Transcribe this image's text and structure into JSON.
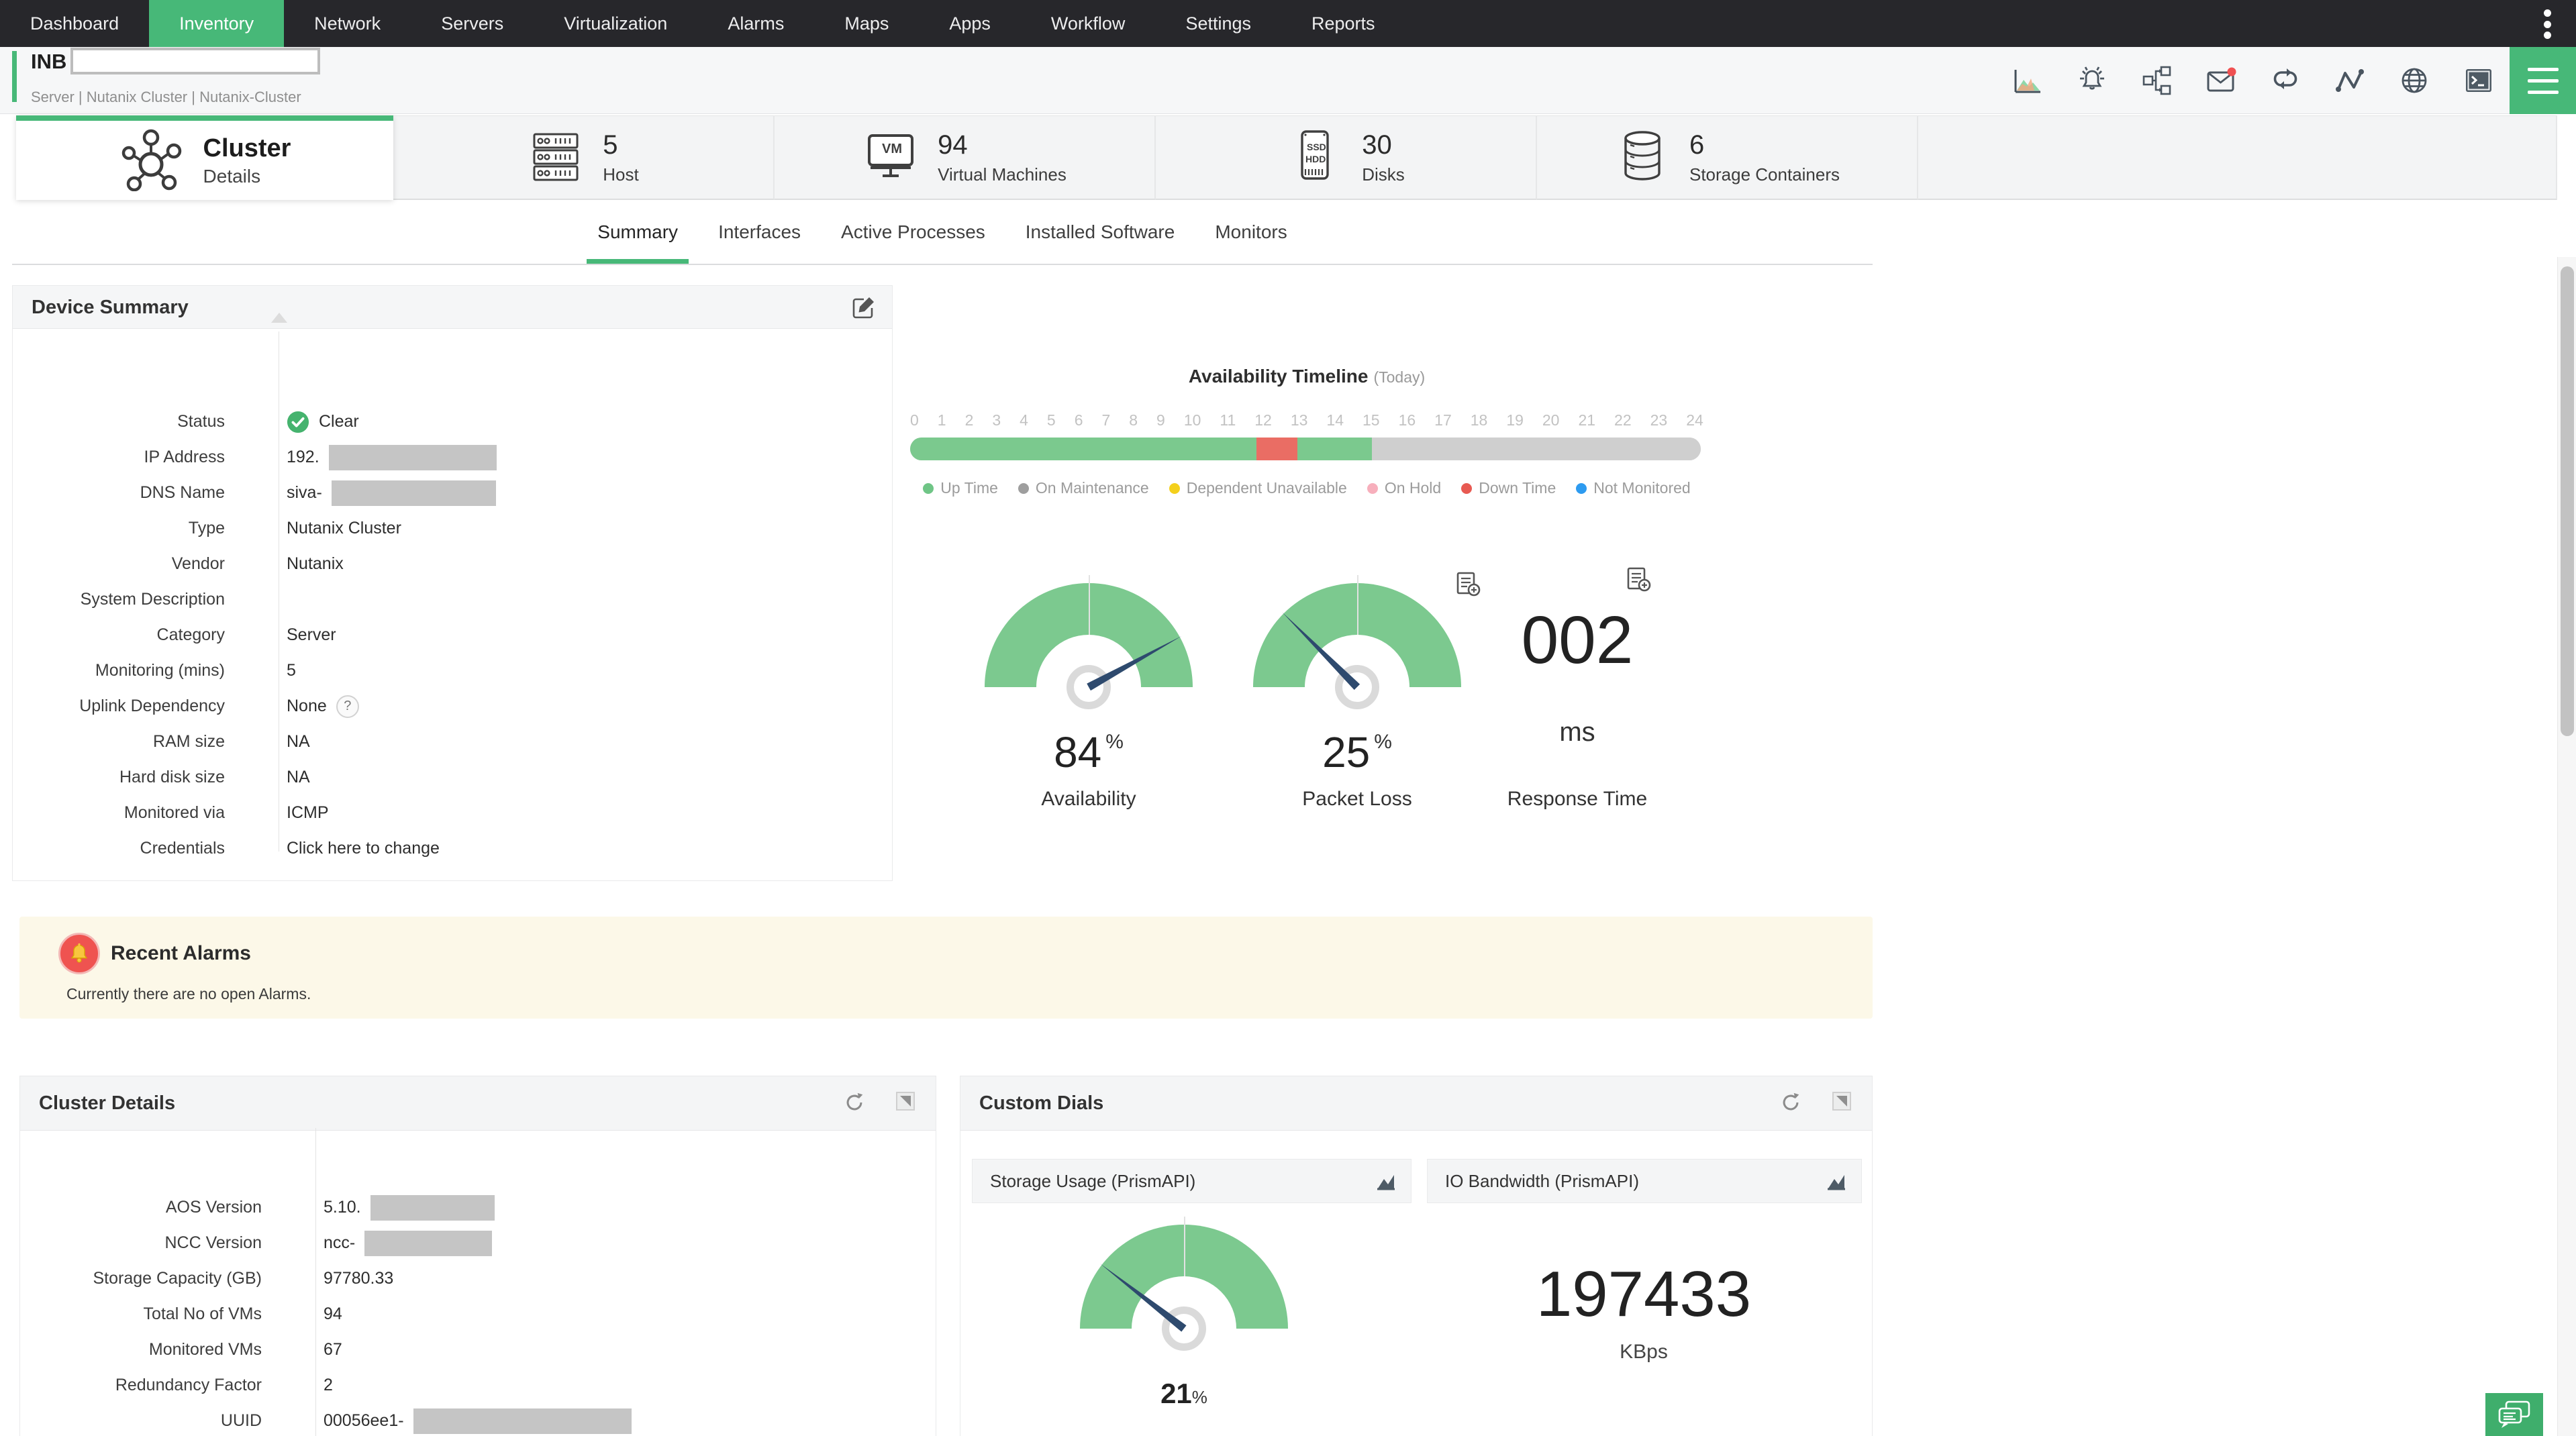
{
  "colors": {
    "accent_green": "#47b878",
    "gauge_green": "#7cc98f",
    "needle_blue": "#2e4a6e",
    "nav_bg": "#27272b",
    "alarm_panel_bg": "#fcf8e8"
  },
  "nav": {
    "items": [
      "Dashboard",
      "Inventory",
      "Network",
      "Servers",
      "Virtualization",
      "Alarms",
      "Maps",
      "Apps",
      "Workflow",
      "Settings",
      "Reports"
    ],
    "active": "Inventory"
  },
  "device_header": {
    "name": "INB",
    "name_redacted": true,
    "breadcrumb": "Server | Nutanix Cluster  | Nutanix-Cluster",
    "action_icons": [
      "performance-graph-icon",
      "alarm-notification-icon",
      "workflow-icon",
      "mail-icon",
      "rediscover-loop-icon",
      "response-pulse-icon",
      "web-globe-icon",
      "terminal-icon"
    ],
    "mail_badge": true
  },
  "entity_cards": {
    "active": {
      "title": "Cluster",
      "subtitle": "Details"
    },
    "items": [
      {
        "count": "5",
        "label": "Host"
      },
      {
        "count": "94",
        "label": "Virtual Machines"
      },
      {
        "count": "30",
        "label": "Disks"
      },
      {
        "count": "6",
        "label": "Storage Containers"
      }
    ]
  },
  "tabs": {
    "items": [
      "Summary",
      "Interfaces",
      "Active Processes",
      "Installed Software",
      "Monitors"
    ],
    "active": "Summary"
  },
  "device_summary": {
    "title": "Device Summary",
    "help_badge": "?",
    "fields": [
      {
        "label": "Status",
        "value": "Clear",
        "status_icon": true
      },
      {
        "label": "IP Address",
        "value": "192.",
        "redacted": true,
        "redact_width": 250
      },
      {
        "label": "DNS Name",
        "value": "siva-",
        "redacted": true,
        "redact_width": 245
      },
      {
        "label": "Type",
        "value": "Nutanix Cluster"
      },
      {
        "label": "Vendor",
        "value": "Nutanix"
      },
      {
        "label": "System Description",
        "value": ""
      },
      {
        "label": "Category",
        "value": "Server"
      },
      {
        "label": "Monitoring (mins)",
        "value": "5"
      },
      {
        "label": "Uplink Dependency",
        "value": "None",
        "help": true
      },
      {
        "label": "RAM size",
        "value": "NA"
      },
      {
        "label": "Hard disk size",
        "value": "NA"
      },
      {
        "label": "Monitored via",
        "value": "ICMP"
      },
      {
        "label": "Credentials",
        "value": "Click here to change",
        "link": true
      }
    ]
  },
  "availability_timeline": {
    "title": "Availability Timeline",
    "subtitle": "(Today)",
    "hours": [
      "0",
      "1",
      "2",
      "3",
      "4",
      "5",
      "6",
      "7",
      "8",
      "9",
      "10",
      "11",
      "12",
      "13",
      "14",
      "15",
      "16",
      "17",
      "18",
      "19",
      "20",
      "21",
      "22",
      "23",
      "24"
    ],
    "segments": [
      {
        "status": "Up Time",
        "pct": 43.8
      },
      {
        "status": "Down Time",
        "pct": 5.2
      },
      {
        "status": "Up Time",
        "pct": 9.4
      },
      {
        "status": "Not Monitored",
        "pct": 41.6
      }
    ],
    "segment_colors": {
      "Up Time": "#7bc98e",
      "Down Time": "#ea6d64",
      "Not Monitored": "#cfcfcf"
    },
    "legend": [
      {
        "label": "Up Time",
        "color": "#6fc586"
      },
      {
        "label": "On Maintenance",
        "color": "#9e9e9e"
      },
      {
        "label": "Dependent Unavailable",
        "color": "#f4d01c"
      },
      {
        "label": "On Hold",
        "color": "#f7afbc"
      },
      {
        "label": "Down Time",
        "color": "#e85a52"
      },
      {
        "label": "Not Monitored",
        "color": "#2d9bf0"
      }
    ]
  },
  "gauges": {
    "availability": {
      "value": "84",
      "unit": "%",
      "label": "Availability",
      "percent": 84
    },
    "packet_loss": {
      "value": "25",
      "unit": "%",
      "label": "Packet Loss",
      "percent": 25
    },
    "response_time": {
      "value": "002",
      "unit": "ms",
      "label": "Response Time"
    }
  },
  "recent_alarms": {
    "title": "Recent Alarms",
    "message": "Currently there are no open Alarms."
  },
  "cluster_details": {
    "title": "Cluster Details",
    "fields": [
      {
        "label": "AOS Version",
        "value": "5.10.",
        "redacted": true,
        "redact_width": 185
      },
      {
        "label": "NCC Version",
        "value": "ncc-",
        "redacted": true,
        "redact_width": 190
      },
      {
        "label": "Storage Capacity (GB)",
        "value": "97780.33"
      },
      {
        "label": "Total No of VMs",
        "value": "94"
      },
      {
        "label": "Monitored VMs",
        "value": "67"
      },
      {
        "label": "Redundancy Factor",
        "value": "2"
      },
      {
        "label": "UUID",
        "value": "00056ee1-",
        "redacted": true,
        "redact_width": 325
      }
    ]
  },
  "custom_dials": {
    "title": "Custom Dials",
    "dials": [
      {
        "name": "Storage Usage (PrismAPI)",
        "type": "gauge",
        "value": "21",
        "unit": "%",
        "percent": 21
      },
      {
        "name": "IO Bandwidth (PrismAPI)",
        "type": "number",
        "value": "197433",
        "unit": "KBps"
      }
    ]
  }
}
